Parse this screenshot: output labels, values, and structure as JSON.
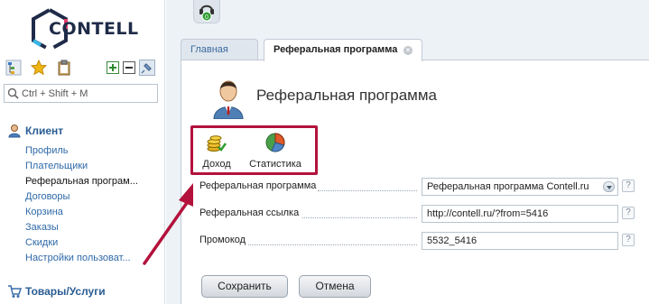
{
  "brand": {
    "logo_text": "CONTELL"
  },
  "sidebar": {
    "search_placeholder": "Ctrl + Shift + M",
    "sections": [
      {
        "title": "Клиент",
        "icon": "user-icon"
      },
      {
        "title": "Товары/Услуги",
        "icon": "cart-icon"
      }
    ],
    "client_items": [
      {
        "label": "Профиль"
      },
      {
        "label": "Плательщики"
      },
      {
        "label": "Реферальная програм..."
      },
      {
        "label": "Договоры"
      },
      {
        "label": "Корзина"
      },
      {
        "label": "Заказы"
      },
      {
        "label": "Скидки"
      },
      {
        "label": "Настройки пользоват..."
      }
    ],
    "active_item_index": 2
  },
  "header": {
    "notification_count": "0"
  },
  "tabs": [
    {
      "label": "Главная"
    },
    {
      "label": "Реферальная программа"
    }
  ],
  "page": {
    "title": "Реферальная программа",
    "actions": [
      {
        "label": "Доход",
        "icon": "coins-icon"
      },
      {
        "label": "Статистика",
        "icon": "pie-chart-icon"
      }
    ],
    "form": {
      "referral_program": {
        "label": "Реферальная программа",
        "value": "Реферальная программа Contell.ru"
      },
      "referral_link": {
        "label": "Реферальная ссылка",
        "value": "http://contell.ru/?from=5416"
      },
      "promo_code": {
        "label": "Промокод",
        "value": "5532_5416"
      }
    },
    "help_label": "?",
    "save_label": "Сохранить",
    "cancel_label": "Отмена"
  },
  "colors": {
    "accent": "#2f69a8",
    "highlight": "#b3123c",
    "panel_bg": "#edf2f7"
  }
}
